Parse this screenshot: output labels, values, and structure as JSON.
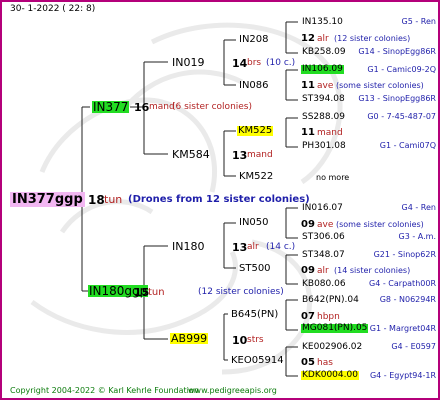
{
  "header": {
    "date": "30-  1-2022 ( 22:  8)"
  },
  "footer": {
    "copyright": "Copyright 2004-2022 © Karl Kehrle Foundation",
    "site": "www.pedigreeapis.org"
  },
  "root": {
    "name": "IN377ggp",
    "year": "18",
    "race": "tun",
    "note": "(Drones from 12 sister colonies)"
  },
  "gen1": {
    "sire": {
      "name": "IN377",
      "year": "16",
      "race": "mand",
      "note": "(6 sister colonies)"
    },
    "dam": {
      "name": "IN180ggp",
      "year": "15",
      "race": "tun",
      "note": "(12 sister colonies)"
    }
  },
  "gen2": {
    "a": {
      "name": "IN019",
      "year": "14",
      "race": "brs",
      "note": "(10 c.)"
    },
    "b": {
      "name": "KM584",
      "year": "13",
      "race": "mand"
    },
    "c": {
      "name": "IN180",
      "year": "13",
      "race": "alr",
      "note": "(14 c.)"
    },
    "d": {
      "name": "AB999",
      "year": "10",
      "race": "strs"
    }
  },
  "gen3": {
    "a1": {
      "name": "IN208"
    },
    "a2": {
      "name": "IN086"
    },
    "b1": {
      "name": "KM525"
    },
    "b2": {
      "name": "KM522"
    },
    "c1": {
      "name": "IN050"
    },
    "c2": {
      "name": "ST500"
    },
    "d1": {
      "name": "B645(PN)"
    },
    "d2": {
      "name": "KEO05914"
    }
  },
  "gen4": [
    {
      "name": "IN135.10",
      "ref": "G5 - Ren"
    },
    {
      "name": "KB258.09",
      "ref": "G14 - SinopEgg86R"
    },
    {
      "name": "IN106.09",
      "ref": "G1 - Camic09-2Q"
    },
    {
      "name": "ST394.08",
      "ref": "G13 - SinopEgg86R"
    },
    {
      "name": "SS288.09",
      "ref": "G0 - 7-45-487-07"
    },
    {
      "name": "PH301.08",
      "ref": "G1 - Cami07Q"
    },
    {
      "name": "no more",
      "ref": ""
    },
    {
      "name": "IN016.07",
      "ref": "G4 - Ren"
    },
    {
      "name": "ST306.06",
      "ref": "G3 - A.m."
    },
    {
      "name": "ST348.07",
      "ref": "G21 - Sinop62R"
    },
    {
      "name": "KB080.06",
      "ref": "G4 - Carpath00R"
    },
    {
      "name": "B642(PN).04",
      "ref": "G8 - N06294R"
    },
    {
      "name": "MG081(PN).05",
      "ref": "G1 - Margret04R"
    },
    {
      "name": "KE002906.02",
      "ref": "G4 - E0597"
    },
    {
      "name": "KDK0004.00",
      "ref": "G4 - Egypt94-1R"
    }
  ],
  "gen3info": {
    "a1": {
      "year": "12",
      "race": "alr",
      "note": "(12 sister colonies)"
    },
    "a2": {
      "year": "11",
      "race": "ave",
      "note": "(some sister colonies)"
    },
    "b1": {
      "year": "11",
      "race": "mand"
    },
    "c1": {
      "year": "09",
      "race": "ave",
      "note": "(some sister colonies)"
    },
    "c2": {
      "year": "09",
      "race": "alr",
      "note": "(14 sister colonies)"
    },
    "d1": {
      "year": "07",
      "race": "hbpn"
    },
    "d2": {
      "year": "05",
      "race": "has"
    }
  }
}
